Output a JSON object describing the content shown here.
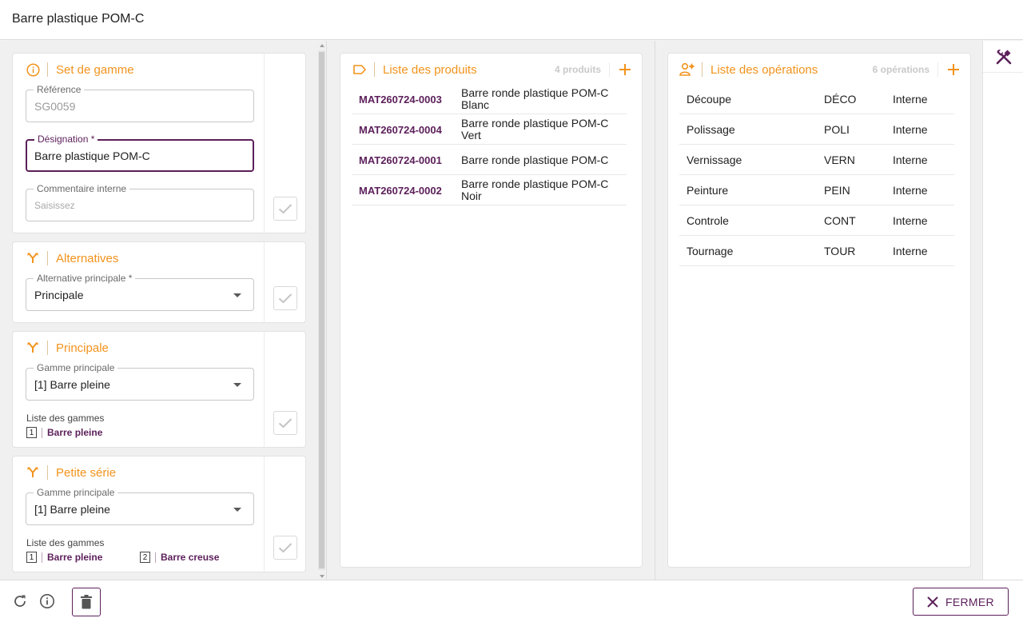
{
  "window": {
    "title": "Barre plastique POM-C"
  },
  "set": {
    "header": "Set de gamme",
    "reference": {
      "label": "Référence",
      "value": "SG0059"
    },
    "designation": {
      "label": "Désignation *",
      "value": "Barre plastique POM-C"
    },
    "comment": {
      "label": "Commentaire interne",
      "placeholder": "Saisissez"
    }
  },
  "alternatives": {
    "header": "Alternatives",
    "main_alt": {
      "label": "Alternative principale *",
      "value": "Principale"
    }
  },
  "principale": {
    "header": "Principale",
    "range": {
      "label": "Gamme principale",
      "value": "[1] Barre pleine"
    },
    "list_label": "Liste des gammes",
    "list": [
      {
        "num": "1",
        "name": "Barre pleine"
      }
    ]
  },
  "petite": {
    "header": "Petite série",
    "range": {
      "label": "Gamme principale",
      "value": "[1] Barre pleine"
    },
    "list_label": "Liste des gammes",
    "list": [
      {
        "num": "1",
        "name": "Barre pleine"
      },
      {
        "num": "2",
        "name": "Barre creuse"
      }
    ]
  },
  "products": {
    "header": "Liste des produits",
    "count": "4 produits",
    "rows": [
      {
        "code": "MAT260724-0003",
        "desc": "Barre ronde plastique POM-C Blanc"
      },
      {
        "code": "MAT260724-0004",
        "desc": "Barre ronde plastique POM-C Vert"
      },
      {
        "code": "MAT260724-0001",
        "desc": "Barre ronde plastique POM-C"
      },
      {
        "code": "MAT260724-0002",
        "desc": "Barre ronde plastique POM-C Noir"
      }
    ]
  },
  "operations": {
    "header": "Liste des opérations",
    "count": "6 opérations",
    "rows": [
      {
        "name": "Découpe",
        "code": "DÉCO",
        "type": "Interne"
      },
      {
        "name": "Polissage",
        "code": "POLI",
        "type": "Interne"
      },
      {
        "name": "Vernissage",
        "code": "VERN",
        "type": "Interne"
      },
      {
        "name": "Peinture",
        "code": "PEIN",
        "type": "Interne"
      },
      {
        "name": "Controle",
        "code": "CONT",
        "type": "Interne"
      },
      {
        "name": "Tournage",
        "code": "TOUR",
        "type": "Interne"
      }
    ]
  },
  "footer": {
    "close_label": "FERMER"
  },
  "icons": {
    "info": "info-icon",
    "fork": "fork-icon",
    "tag": "tag-icon",
    "people": "people-gear-icon",
    "plus": "plus-icon",
    "check": "check-icon",
    "tools": "tools-icon",
    "refresh": "refresh-icon",
    "trash": "trash-icon",
    "close": "close-icon"
  },
  "colors": {
    "accent": "#f2931c",
    "brand": "#5c1f5a",
    "muted": "#c9c9c9"
  }
}
